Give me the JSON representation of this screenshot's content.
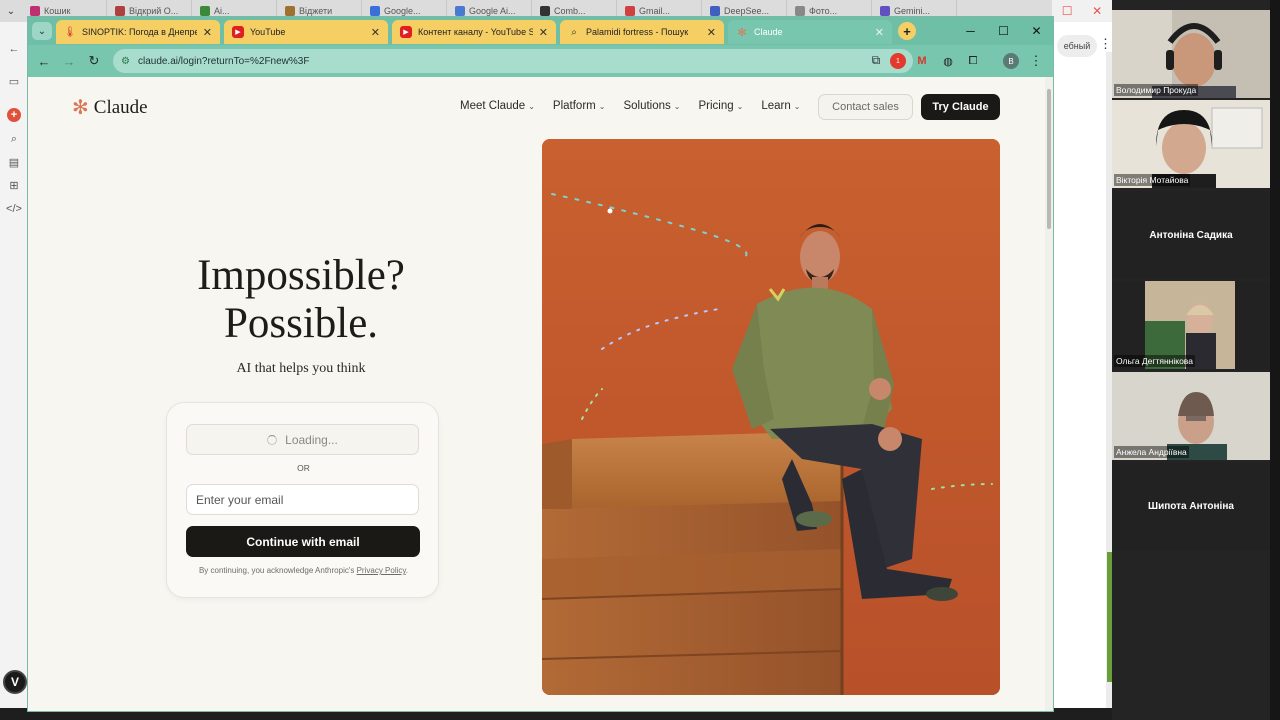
{
  "background_tabs": [
    "Кошик",
    "Відкрий О...",
    "Ai...",
    "Віджети",
    "Google...",
    "Google Ai...",
    "Comb...",
    "Gmail...",
    "DeepSee...",
    "Фото...",
    "Gemini..."
  ],
  "bg_pill": "ебный",
  "bg_badge": "V",
  "tabs": [
    {
      "title": "SINOPTIK: Погода в Днепре н",
      "icon": "thermometer-icon"
    },
    {
      "title": "YouTube",
      "icon": "youtube-icon"
    },
    {
      "title": "Контент каналу - YouTube Stu",
      "icon": "youtube-icon"
    },
    {
      "title": "Palamidi fortress - Пошук",
      "icon": "search-icon"
    },
    {
      "title": "Claude",
      "icon": "claude-icon"
    }
  ],
  "address": "claude.ai/login?returnTo=%2Fnew%3F",
  "profile_initial": "B",
  "ext_badge": "1",
  "site": {
    "logo": "Claude",
    "nav": [
      "Meet Claude",
      "Platform",
      "Solutions",
      "Pricing",
      "Learn"
    ],
    "contact_sales": "Contact sales",
    "try_claude": "Try Claude",
    "hero_line1": "Impossible?",
    "hero_line2": "Possible.",
    "hero_sub": "AI that helps you think",
    "loading": "Loading...",
    "or": "OR",
    "email_placeholder": "Enter your email",
    "continue": "Continue with email",
    "legal_prefix": "By continuing, you acknowledge Anthropic's ",
    "privacy": "Privacy Policy",
    "legal_suffix": "."
  },
  "video_call": [
    {
      "name": "Володимир Прокуда",
      "video": true
    },
    {
      "name": "Вікторія Мотайова",
      "video": true
    },
    {
      "name": "Антоніна Садика",
      "video": false
    },
    {
      "name": "Ольга Дегтяннікова",
      "video": true
    },
    {
      "name": "Анжела Андріївна",
      "video": true
    },
    {
      "name": "Шипота Антоніна",
      "video": false
    }
  ],
  "colors": {
    "accent": "#d97757",
    "tabstrip": "#6fbfa7",
    "tab": "#f6cf64",
    "dark": "#1a1915"
  }
}
